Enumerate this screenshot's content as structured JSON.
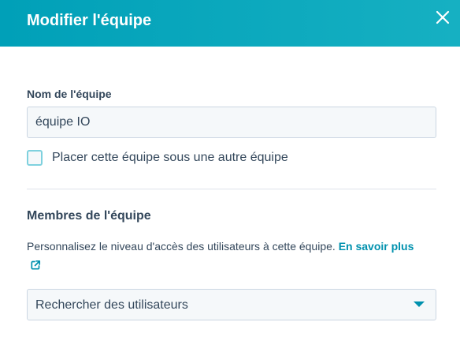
{
  "dialog": {
    "title": "Modifier l'équipe",
    "close_icon": "close-icon"
  },
  "team_name": {
    "label": "Nom de l'équipe",
    "value": "équipe IO"
  },
  "parent_team": {
    "checked": false,
    "label": "Placer cette équipe sous une autre équipe"
  },
  "members": {
    "title": "Membres de l'équipe",
    "help_text": "Personnalisez le niveau d'accès des utilisateurs à cette équipe.",
    "learn_more_label": "En savoir plus",
    "learn_more_icon": "external-link-icon",
    "search_placeholder": "Rechercher des utilisateurs",
    "dropdown_icon": "chevron-down-icon"
  },
  "colors": {
    "header": "#00a0b8",
    "link": "#0091ae",
    "text": "#33475b",
    "input_bg": "#f5f8fa",
    "input_border": "#cbd6e2"
  }
}
